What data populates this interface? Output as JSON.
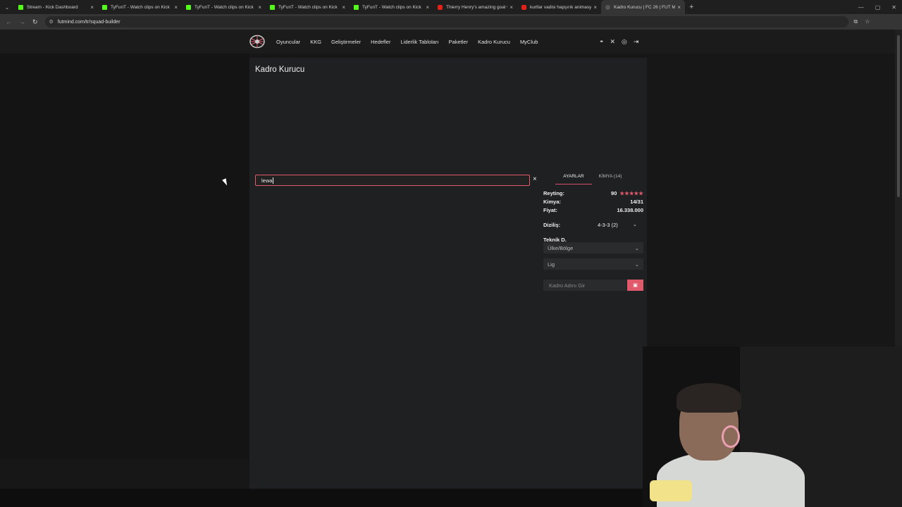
{
  "browser": {
    "tabs": [
      {
        "title": "Stream - Kick Dashboard",
        "icon": "kick-icon"
      },
      {
        "title": "TyFunT - Watch clips on Kick",
        "icon": "kick-icon"
      },
      {
        "title": "TyFunT - Watch clips on Kick",
        "icon": "kick-icon"
      },
      {
        "title": "TyFunT - Watch clips on Kick",
        "icon": "kick-icon"
      },
      {
        "title": "TyFunT - Watch clips on Kick",
        "icon": "kick-icon"
      },
      {
        "title": "Thierry Henry's amazing goal vs",
        "icon": "youtube-icon"
      },
      {
        "title": "kurtlar vadisi hapşırık animasyo",
        "icon": "youtube-icon"
      },
      {
        "title": "Kadro Kurucu | FC 26 | FUT Min",
        "icon": "futmind-icon",
        "active": true
      }
    ],
    "url": "futmind.com/tr/squad-builder"
  },
  "nav": {
    "items": [
      "Oyuncular",
      "KKG",
      "Geliştirmeler",
      "Hedefler",
      "Liderlik Tabloları",
      "Paketler",
      "Kadro Kurucu",
      "MyClub"
    ]
  },
  "page": {
    "title": "Kadro Kurucu",
    "search_value": "lewa",
    "clear_symbol": "×"
  },
  "settings": {
    "tab_settings": "AYARLAR",
    "tab_chemistry": "KİMYA (14)",
    "rating_label": "Reyting:",
    "rating_value": "90",
    "rating_stars": "★★★★★",
    "chemistry_label": "Kimya:",
    "chemistry_value": "14/31",
    "price_label": "Fiyat:",
    "price_value": "16.338.000",
    "formation_label": "Diziliş:",
    "formation_value": "4-3-3 (2)",
    "coach_label": "Teknik D.",
    "country_placeholder": "Ülke/Bölge",
    "league_placeholder": "Lig",
    "squad_name_placeholder": "Kadro Adını Gir"
  },
  "colors": {
    "accent": "#e05a6b",
    "panel": "#1f2021",
    "background": "#171717"
  }
}
